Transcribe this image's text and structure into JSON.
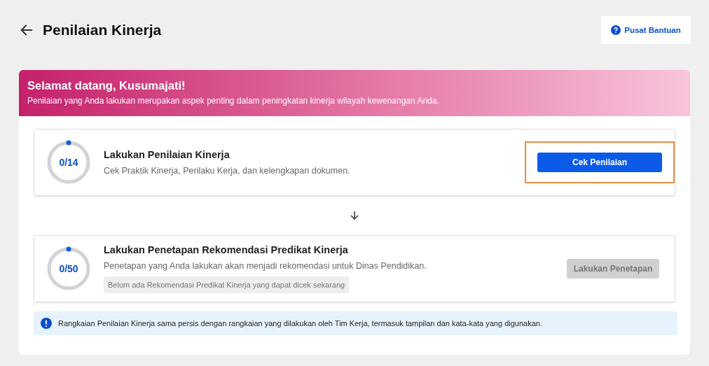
{
  "header": {
    "title": "Penilaian Kinerja",
    "help_button": "Pusat Bantuan"
  },
  "banner": {
    "title": "Selamat datang, Kusumajati!",
    "text": "Penilaian yang Anda lakukan merupakan aspek penting dalam peningkatan kinerja wilayah kewenangan Anda."
  },
  "steps": [
    {
      "progress": "0/14",
      "level": 0,
      "title": "Lakukan Penilaian Kinerja",
      "description": "Cek Praktik Kinerja, Perilaku Kerja, dan kelengkapan dokumen.",
      "button": "Cek Penilaian",
      "disabled": false,
      "highlighted": true
    },
    {
      "progress": "0/50",
      "level": 0,
      "title": "Lakukan Penetapan Rekomendasi Predikat Kinerja",
      "description": "Penetapan yang Anda lakukan akan menjadi rekomendasi untuk Dinas Pendidikan.",
      "note": "Belum ada Rekomendasi Predikat Kinerja yang dapat dicek sekarang",
      "button": "Lakukan Penetapan",
      "disabled": true,
      "highlighted": false
    }
  ],
  "info": "Rangkaian Penilaian Kinerja sama persis dengan rangkaian yang dilakukan oleh Tim Kerja, termasuk tampilan dan kata-kata yang digunakan."
}
